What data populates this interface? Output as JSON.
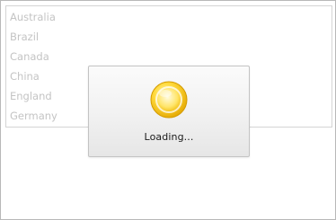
{
  "list": {
    "items": [
      {
        "label": "Australia"
      },
      {
        "label": "Brazil"
      },
      {
        "label": "Canada"
      },
      {
        "label": "China"
      },
      {
        "label": "England"
      },
      {
        "label": "Germany"
      }
    ]
  },
  "overlay": {
    "loading_text": "Loading...",
    "spinner_icon": "loading-spinner-icon",
    "spinner_color": "#f6c600"
  }
}
